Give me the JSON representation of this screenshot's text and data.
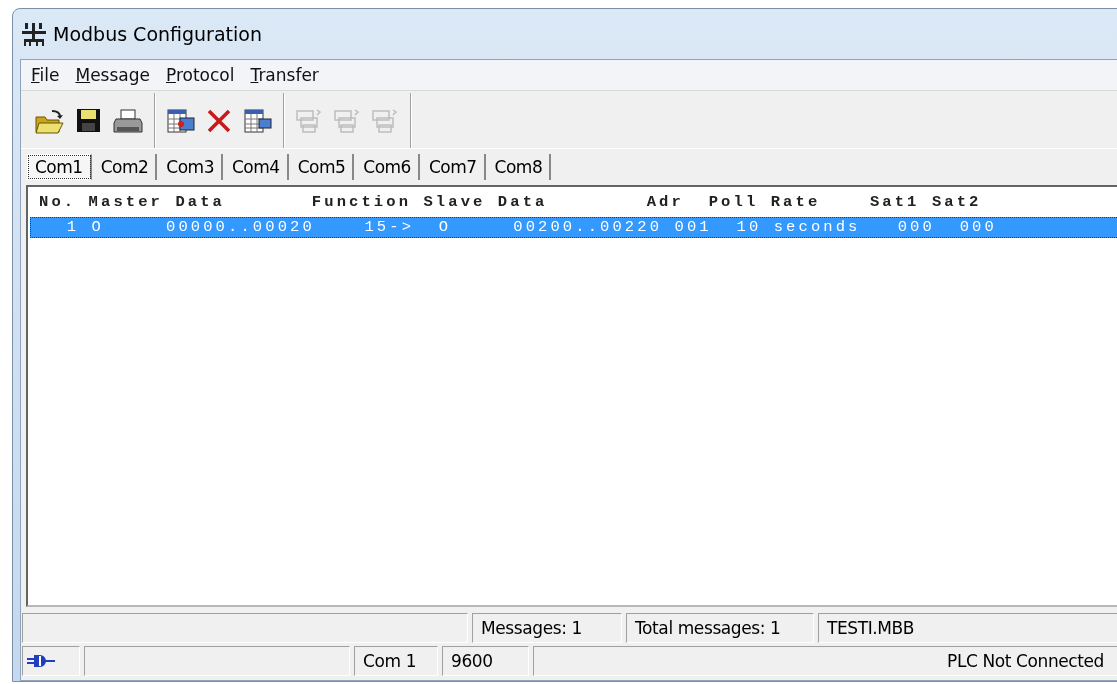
{
  "window": {
    "title": "Modbus Configuration"
  },
  "menu": [
    "File",
    "Message",
    "Protocol",
    "Transfer"
  ],
  "toolbar": [
    [
      {
        "kind": "open",
        "disabled": false
      },
      {
        "kind": "save",
        "disabled": false
      },
      {
        "kind": "print",
        "disabled": false
      }
    ],
    [
      {
        "kind": "add",
        "disabled": false
      },
      {
        "kind": "delete",
        "disabled": false
      },
      {
        "kind": "edit",
        "disabled": false
      }
    ],
    [
      {
        "kind": "link",
        "disabled": true
      },
      {
        "kind": "link",
        "disabled": true
      },
      {
        "kind": "link",
        "disabled": true
      }
    ]
  ],
  "tabs": [
    {
      "label": "Com1",
      "selected": true
    },
    {
      "label": "Com2",
      "selected": false
    },
    {
      "label": "Com3",
      "selected": false
    },
    {
      "label": "Com4",
      "selected": false
    },
    {
      "label": "Com5",
      "selected": false
    },
    {
      "label": "Com6",
      "selected": false
    },
    {
      "label": "Com7",
      "selected": false
    },
    {
      "label": "Com8",
      "selected": false
    }
  ],
  "list": {
    "header": "No. Master Data       Function Slave Data        Adr  Poll Rate    Sat1 Sat2",
    "rows": [
      {
        "text": "  1 O     00000..00020    15->  O     00200..00220 001  10 seconds   000  000",
        "selected": true
      }
    ]
  },
  "status_bars": [
    {
      "panels": [
        {
          "kind": "blank"
        },
        {
          "kind": "text",
          "text": "Messages: 1"
        },
        {
          "kind": "text",
          "text": "Total messages: 1"
        },
        {
          "kind": "text",
          "text": "TESTI.MBB"
        }
      ]
    },
    {
      "panels": [
        {
          "kind": "connection"
        },
        {
          "kind": "blank"
        },
        {
          "kind": "text",
          "text": "Com 1"
        },
        {
          "kind": "text",
          "text": "9600"
        },
        {
          "kind": "text",
          "text": "PLC Not Connected"
        }
      ]
    }
  ]
}
